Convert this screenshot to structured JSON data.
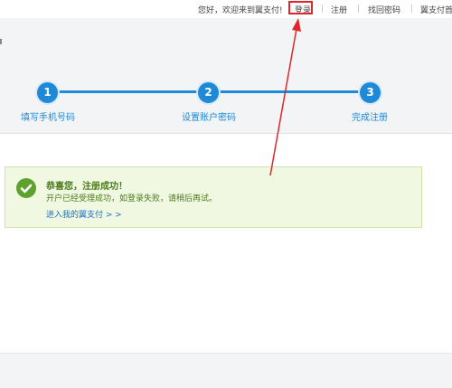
{
  "topbar": {
    "greeting": "您好，欢迎来到翼支付!",
    "login": "登录",
    "register": "注册",
    "recover_password": "找回密码",
    "yizhifu_home": "翼支付首"
  },
  "steps": [
    {
      "number": "1",
      "label": "填写手机号码"
    },
    {
      "number": "2",
      "label": "设置账户密码"
    },
    {
      "number": "3",
      "label": "完成注册"
    }
  ],
  "success": {
    "title": "恭喜您，注册成功！",
    "desc": "开户已经受理成功，如登录失败，请稍后再试。",
    "link": "进入我的翼支付 > >"
  },
  "colors": {
    "accent": "#1e89d6",
    "success_bg": "#f0f8e2",
    "success_text": "#4a7b17",
    "highlight": "#e0252b"
  }
}
